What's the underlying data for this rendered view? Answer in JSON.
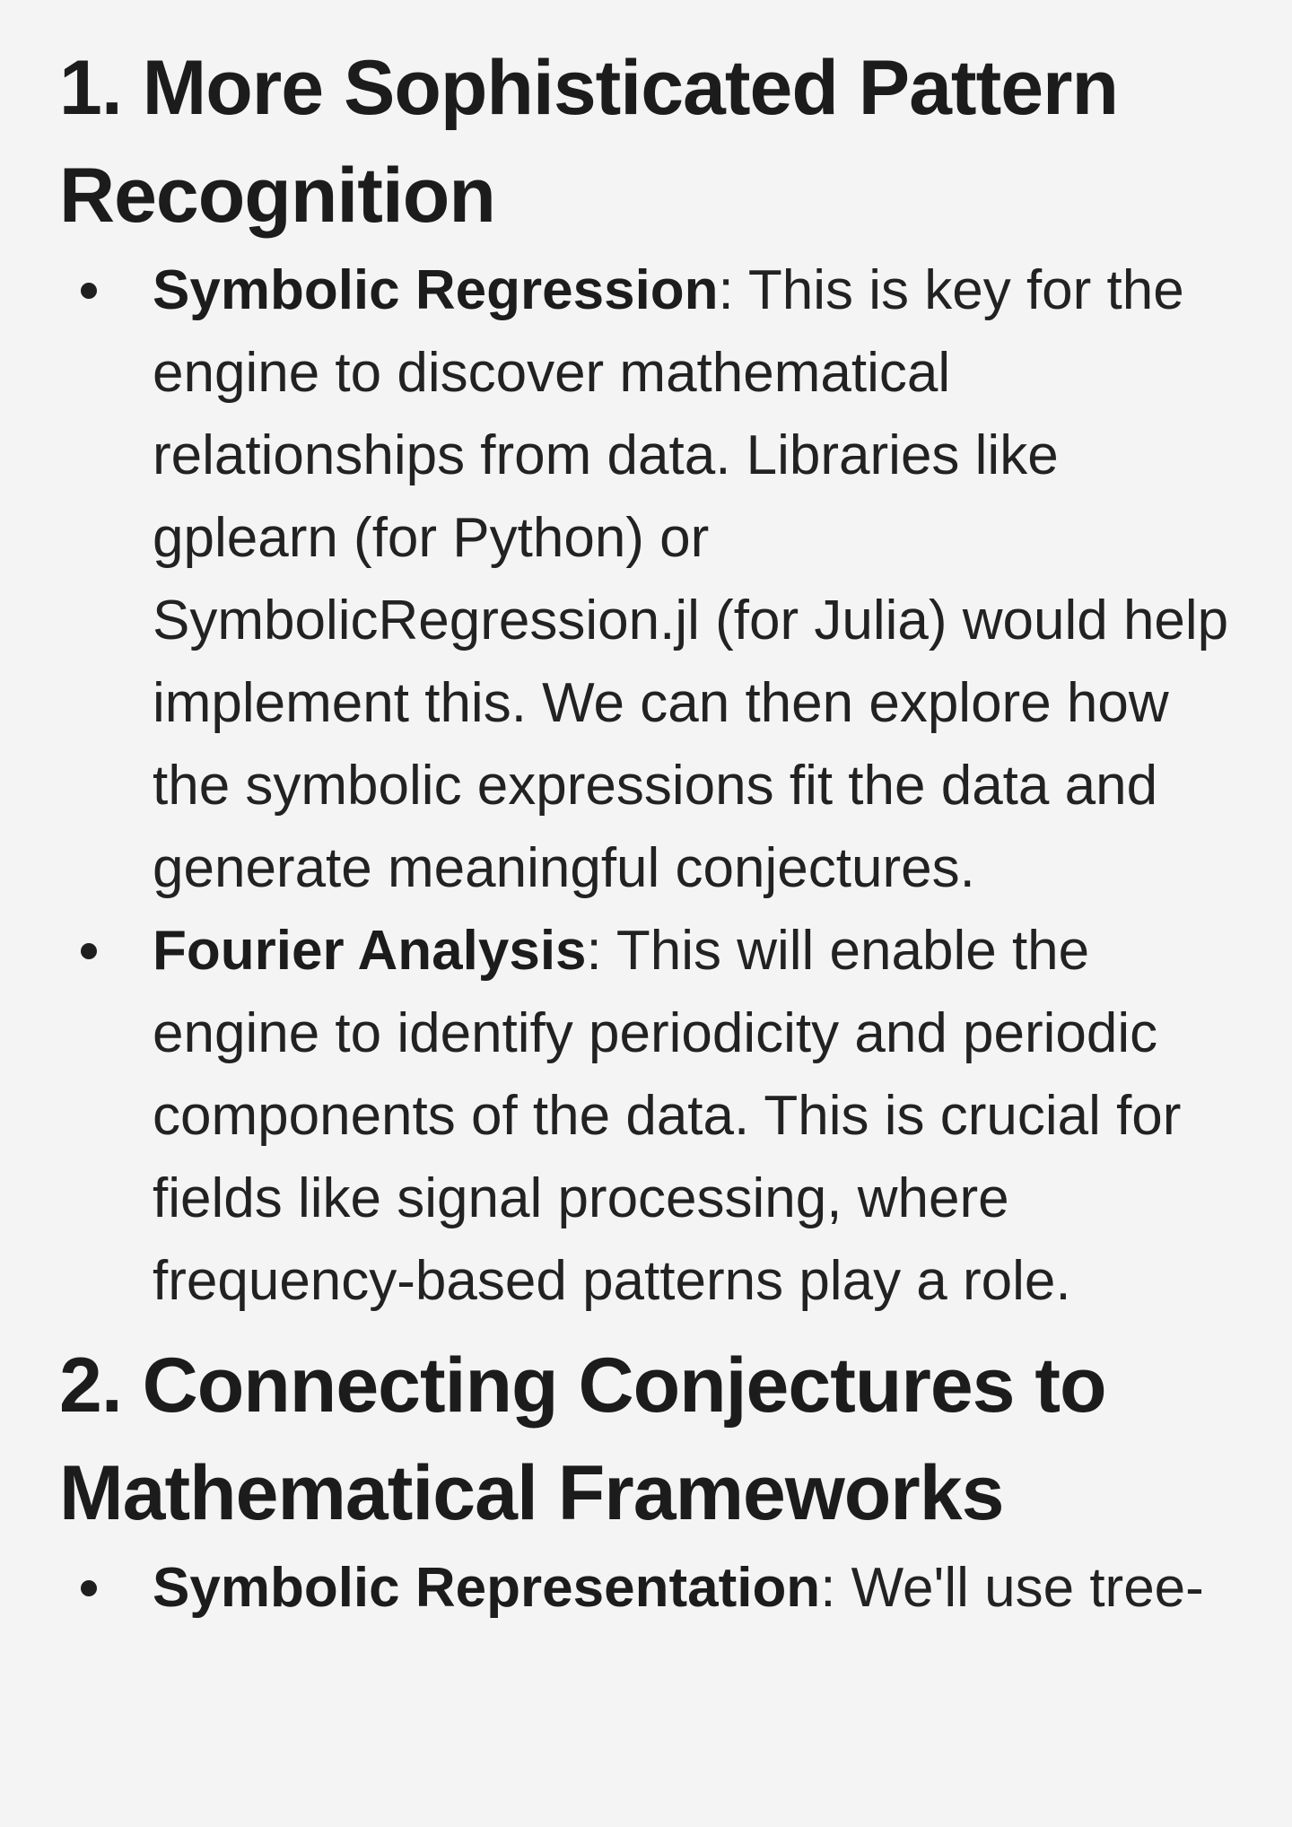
{
  "sections": [
    {
      "title": "1. More Sophisticated Pattern Recognition",
      "items": [
        {
          "term": "Symbolic Regression",
          "separator": ":",
          "text": " This is key for the engine to discover mathematical relationships from data. Libraries like gplearn (for Python) or SymbolicRegression.jl (for Julia) would help implement this. We can then explore how the symbolic expressions fit the data and generate meaningful conjectures."
        },
        {
          "term": "Fourier Analysis",
          "separator": ":",
          "text": " This will enable the engine to identify periodicity and periodic components of the data. This is crucial for fields like signal processing, where frequency-based patterns play a role."
        }
      ]
    },
    {
      "title": "2. Connecting Conjectures to Mathematical Frameworks",
      "items": [
        {
          "term": "Symbolic Representation",
          "separator": ":",
          "text": " We'll use tree-"
        }
      ]
    }
  ]
}
